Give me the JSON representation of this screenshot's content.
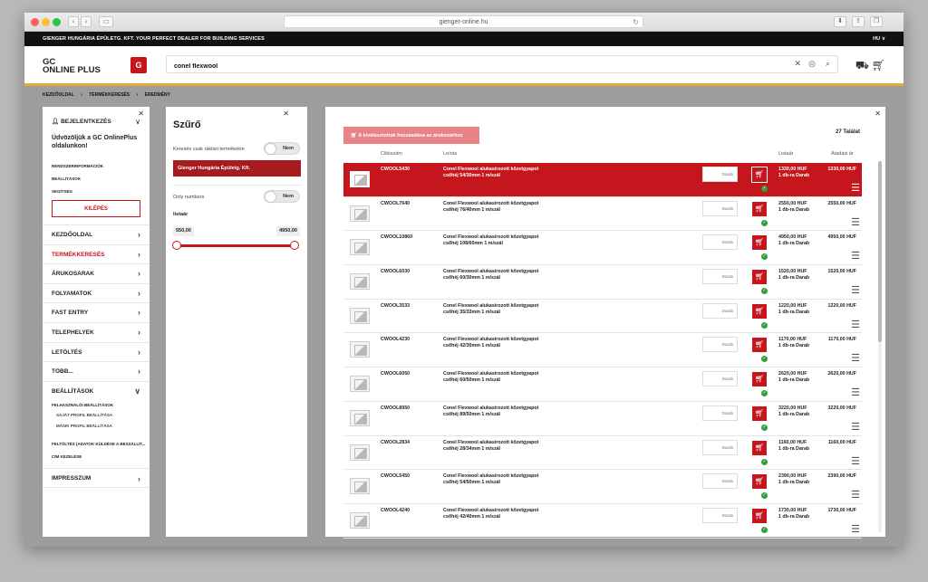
{
  "browser": {
    "url": "gienger-online.hu",
    "back_icon": "chevron-left-icon",
    "forward_icon": "chevron-right-icon"
  },
  "topbar": {
    "text": "GIENGER HUNGÁRIA ÉPÜLETG. KFT. YOUR PERFECT DEALER FOR BUILDING SERVICES",
    "lang": "HU ∨"
  },
  "header": {
    "logo_line1": "GC",
    "logo_line2": "ONLINE PLUS",
    "badge": "G",
    "search_value": "conel flexwool"
  },
  "breadcrumb": [
    "KEZDŐOLDAL",
    "›",
    "TERMÉKKERESÉS",
    "›",
    "EREDMÉNY"
  ],
  "sidebar": {
    "login": "BEJELENTKEZÉS",
    "welcome": "Üdvözöljük a GC OnlinePlus oldalunkon!",
    "links": [
      "RENDSZERINFORMÁCIÓK",
      "BEÁLLÍTÁSOK",
      "SEGÍTSÉG"
    ],
    "logout": "KILÉPÉS",
    "menu": [
      "KEZDŐOLDAL",
      "TERMÉKKERESÉS",
      "ÁRUKOSARAK",
      "FOLYAMATOK",
      "FAST ENTRY",
      "TELEPHELYEK",
      "LETÖLTÉS",
      "TÖBB...",
      "BEÁLLÍTÁSOK"
    ],
    "sub": [
      "FELHASZNÁLÓI BEÁLLÍTÁSOK",
      "SAJÁT PROFIL BEÁLLÍTÁSA",
      "MÁSIK PROFIL BEÁLLÍTÁSA",
      "FELTÖLTÉS (ADATOK KÜLDÉSE A BESZÁLLÍT...",
      "CÍM KEZELÉSE"
    ],
    "impresszum": "IMPRESSZUM"
  },
  "filter": {
    "title": "Szűrő",
    "stock_label": "Keresés csak raktári termékekre",
    "stock_toggle": "Nem",
    "company": "Gienger Hungária Épületg. Kft.",
    "only_numbers": "Only numbers",
    "only_toggle": "Nem",
    "list_label": "listaár",
    "min": "550,00",
    "max": "4950,00"
  },
  "results": {
    "add_button": "A kiválasztottak hozzáadása az árukosárhoz",
    "count": "27 Találat",
    "headers": {
      "code": "Cikkszám",
      "desc": "Leírás",
      "list": "Listaár",
      "net": "Átadási ár"
    },
    "qty_placeholder": "Darab",
    "rows": [
      {
        "code": "CWOOL5430",
        "d1": "Conel Flexwool alukasirozott kőzetgyapot",
        "d2": "csőhéj 54/30mm 1 m/szál",
        "p1": "1330,00 HUF",
        "p2": "1 db-ra Darab",
        "net": "1330,00 HUF"
      },
      {
        "code": "CWOOL7640",
        "d1": "Conel Flexwool alukasirozott kőzetgyapot",
        "d2": "csőhéj 76/40mm 1 m/szál",
        "p1": "2550,00 HUF",
        "p2": "1 db-ra Darab",
        "net": "2550,00 HUF"
      },
      {
        "code": "CWOOL10860",
        "d1": "Conel Flexwool alukasirozott kőzetgyapot",
        "d2": "csőhéj 108/60mm 1 m/szál",
        "p1": "4950,00 HUF",
        "p2": "1 db-ra Darab",
        "net": "4950,00 HUF"
      },
      {
        "code": "CWOOL6030",
        "d1": "Conel Flexwool alukasirozott kőzetgyapot",
        "d2": "csőhéj 60/30mm 1 m/szál",
        "p1": "1520,00 HUF",
        "p2": "1 db-ra Darab",
        "net": "1520,00 HUF"
      },
      {
        "code": "CWOOL3533",
        "d1": "Conel Flexwool alukasirozott kőzetgyapot",
        "d2": "csőhéj 35/33mm 1 m/szál",
        "p1": "1220,00 HUF",
        "p2": "1 db-ra Darab",
        "net": "1220,00 HUF"
      },
      {
        "code": "CWOOL4230",
        "d1": "Conel Flexwool alukasirozott kőzetgyapot",
        "d2": "csőhéj 42/30mm 1 m/szál",
        "p1": "1170,00 HUF",
        "p2": "1 db-ra Darab",
        "net": "1170,00 HUF"
      },
      {
        "code": "CWOOL6050",
        "d1": "Conel Flexwool alukasirozott kőzetgyapot",
        "d2": "csőhéj 60/50mm 1 m/szál",
        "p1": "2620,00 HUF",
        "p2": "1 db-ra Darab",
        "net": "2620,00 HUF"
      },
      {
        "code": "CWOOL8950",
        "d1": "Conel Flexwool alukasirozott kőzetgyapot",
        "d2": "csőhéj 89/50mm 1 m/szál",
        "p1": "3220,00 HUF",
        "p2": "1 db-ra Darab",
        "net": "3220,00 HUF"
      },
      {
        "code": "CWOOL2834",
        "d1": "Conel Flexwool alukasirozott kőzetgyapot",
        "d2": "csőhéj 28/34mm 1 m/szál",
        "p1": "1160,00 HUF",
        "p2": "1 db-ra Darab",
        "net": "1160,00 HUF"
      },
      {
        "code": "CWOOL5450",
        "d1": "Conel Flexwool alukasirozott kőzetgyapot",
        "d2": "csőhéj 54/50mm 1 m/szál",
        "p1": "2390,00 HUF",
        "p2": "1 db-ra Darab",
        "net": "2390,00 HUF"
      },
      {
        "code": "CWOOL4240",
        "d1": "Conel Flexwool alukasirozott kőzetgyapot",
        "d2": "csőhéj 42/40mm 1 m/szál",
        "p1": "1730,00 HUF",
        "p2": "1 db-ra Darab",
        "net": "1730,00 HUF"
      }
    ]
  },
  "colors": {
    "brand_red": "#c4161c",
    "accent_gold": "#e2a93b"
  }
}
